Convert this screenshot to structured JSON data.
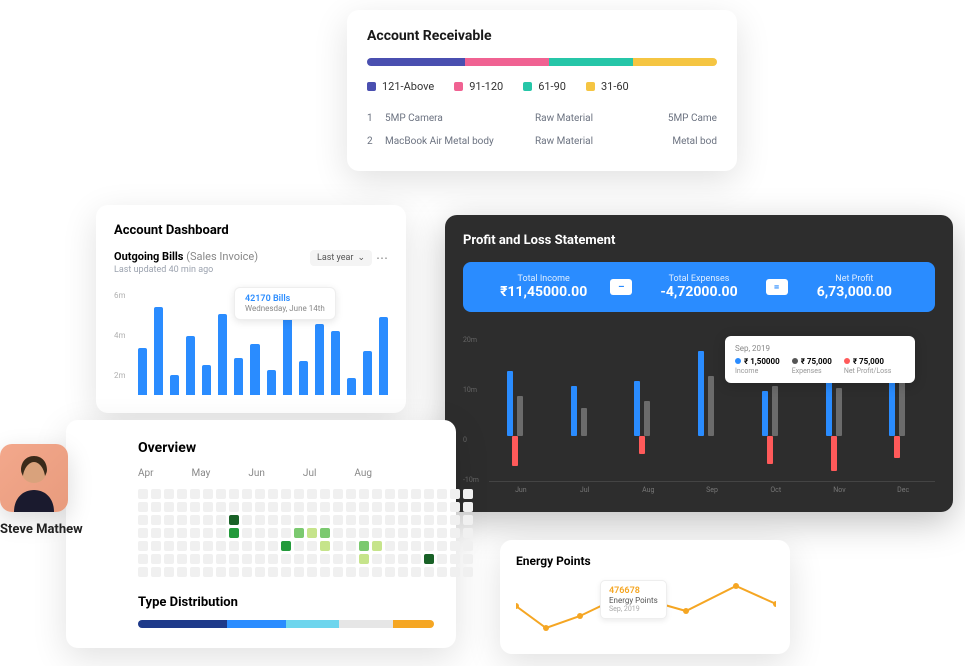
{
  "account_receivable": {
    "title": "Account Receivable",
    "segments": [
      {
        "label": "121-Above",
        "color": "#4a4fb0",
        "width": 28
      },
      {
        "label": "91-120",
        "color": "#f06292",
        "width": 24
      },
      {
        "label": "61-90",
        "color": "#26c6a8",
        "width": 24
      },
      {
        "label": "31-60",
        "color": "#f5c542",
        "width": 24
      }
    ],
    "rows": [
      {
        "idx": "1",
        "name": "5MP Camera",
        "type": "Raw Material",
        "last": "5MP Came"
      },
      {
        "idx": "2",
        "name": "MacBook Air Metal body",
        "type": "Raw Material",
        "last": "Metal bod"
      }
    ]
  },
  "account_dashboard": {
    "title": "Account Dashboard",
    "subtitle_bold": "Outgoing Bills",
    "subtitle_light": "(Sales Invoice)",
    "updated": "Last updated 40 min ago",
    "filter": "Last year",
    "tooltip": {
      "top": "42170 Bills",
      "bottom": "Wednesday, June 14th"
    }
  },
  "profit_loss": {
    "title": "Profit and Loss Statement",
    "income_label": "Total Income",
    "income_value": "₹11,45000.00",
    "expenses_label": "Total Expenses",
    "expenses_value": "-4,72000.00",
    "profit_label": "Net Profit",
    "profit_value": "6,73,000.00",
    "op_minus": "–",
    "op_equals": "=",
    "tooltip": {
      "date": "Sep, 2019",
      "items": [
        {
          "color": "#2a8cff",
          "value": "₹ 1,50000",
          "label": "Income"
        },
        {
          "color": "#555",
          "value": "₹ 75,000",
          "label": "Expenses"
        },
        {
          "color": "#ff5a5a",
          "value": "₹ 75,000",
          "label": "Net Profit/Loss"
        }
      ]
    }
  },
  "overview": {
    "title": "Overview",
    "months": [
      "Apr",
      "May",
      "Jun",
      "Jul",
      "Aug"
    ],
    "type_title": "Type Distribution",
    "type_segments": [
      {
        "color": "#1e3a8a",
        "width": 30
      },
      {
        "color": "#2a8cff",
        "width": 20
      },
      {
        "color": "#6dd5ed",
        "width": 18
      },
      {
        "color": "#e6e6e6",
        "width": 18
      },
      {
        "color": "#f5a623",
        "width": 14
      }
    ]
  },
  "avatar": {
    "name": "Steve Mathew"
  },
  "energy_points": {
    "title": "Energy Points",
    "tooltip": {
      "value": "476678",
      "label": "Energy Points",
      "date": "Sep, 2019"
    }
  },
  "chart_data": [
    {
      "type": "bar",
      "title": "Outgoing Bills (Sales Invoice)",
      "ylabel_ticks": [
        "6m",
        "4m",
        "2m"
      ],
      "ylim": [
        0,
        6500000
      ],
      "values": [
        2800000,
        5200000,
        1200000,
        3500000,
        1800000,
        4800000,
        2200000,
        3000000,
        1500000,
        5600000,
        2000000,
        4200000,
        3800000,
        1000000,
        2600000,
        4600000
      ]
    },
    {
      "type": "bar",
      "title": "Profit and Loss Statement",
      "categories": [
        "Jun",
        "Jul",
        "Aug",
        "Sep",
        "Oct",
        "Nov",
        "Dec"
      ],
      "ylabel_ticks": [
        "20m",
        "10m",
        "0",
        "-10m"
      ],
      "series": [
        {
          "name": "Income",
          "color": "#2a8cff",
          "values": [
            65,
            50,
            55,
            85,
            45,
            70,
            78
          ]
        },
        {
          "name": "Expenses",
          "color": "#6b6b6b",
          "values": [
            40,
            28,
            35,
            60,
            50,
            48,
            88
          ]
        },
        {
          "name": "Net Profit/Loss",
          "color": "#ff5a5a",
          "values": [
            -30,
            0,
            -18,
            0,
            -28,
            -35,
            -22
          ]
        }
      ]
    },
    {
      "type": "line",
      "title": "Energy Points",
      "x": [
        0,
        30,
        64,
        110,
        170,
        220,
        260
      ],
      "values": [
        30,
        52,
        40,
        18,
        35,
        10,
        28
      ]
    }
  ]
}
